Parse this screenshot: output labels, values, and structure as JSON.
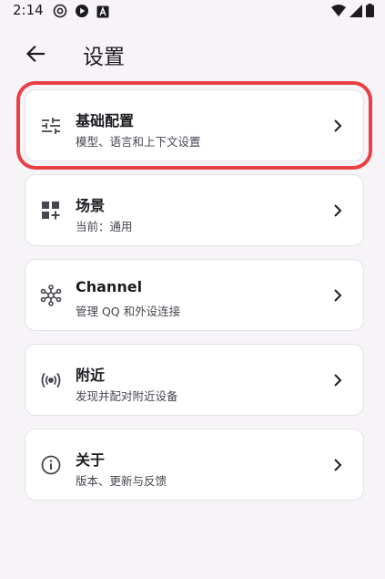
{
  "status_bar": {
    "time": "2:14",
    "left_icons": [
      "at-sign-icon",
      "play-icon",
      "letter-a-icon"
    ],
    "right_icons": [
      "wifi-icon",
      "signal-icon",
      "battery-icon"
    ]
  },
  "app_bar": {
    "title": "设置",
    "back_icon": "arrow-left-icon"
  },
  "colors": {
    "background": "#f7f4f8",
    "card": "#ffffff",
    "highlight": "#ea3f44",
    "text_primary": "#1d1b20",
    "text_secondary": "#49454f"
  },
  "settings": [
    {
      "icon": "tune-sliders-icon",
      "title": "基础配置",
      "subtitle": "模型、语言和上下文设置",
      "highlighted": true
    },
    {
      "icon": "widgets-add-icon",
      "title": "场景",
      "subtitle": "当前：通用",
      "highlighted": false
    },
    {
      "icon": "hub-network-icon",
      "title": "Channel",
      "subtitle": "管理 QQ 和外设连接",
      "highlighted": false
    },
    {
      "icon": "broadcast-icon",
      "title": "附近",
      "subtitle": "发现并配对附近设备",
      "highlighted": false
    },
    {
      "icon": "info-icon",
      "title": "关于",
      "subtitle": "版本、更新与反馈",
      "highlighted": false
    }
  ]
}
